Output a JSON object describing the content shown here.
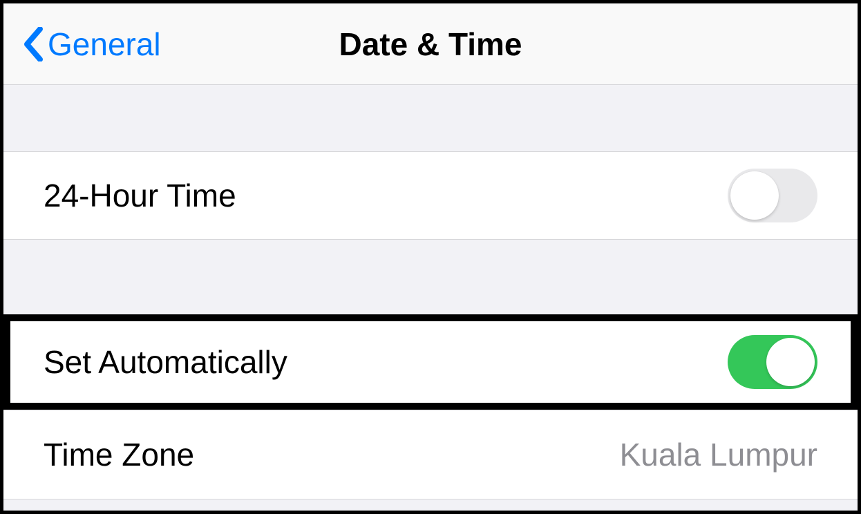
{
  "header": {
    "back_label": "General",
    "title": "Date & Time"
  },
  "rows": {
    "twenty_four_hour": {
      "label": "24-Hour Time",
      "on": false
    },
    "set_automatically": {
      "label": "Set Automatically",
      "on": true
    },
    "time_zone": {
      "label": "Time Zone",
      "value": "Kuala Lumpur"
    }
  }
}
